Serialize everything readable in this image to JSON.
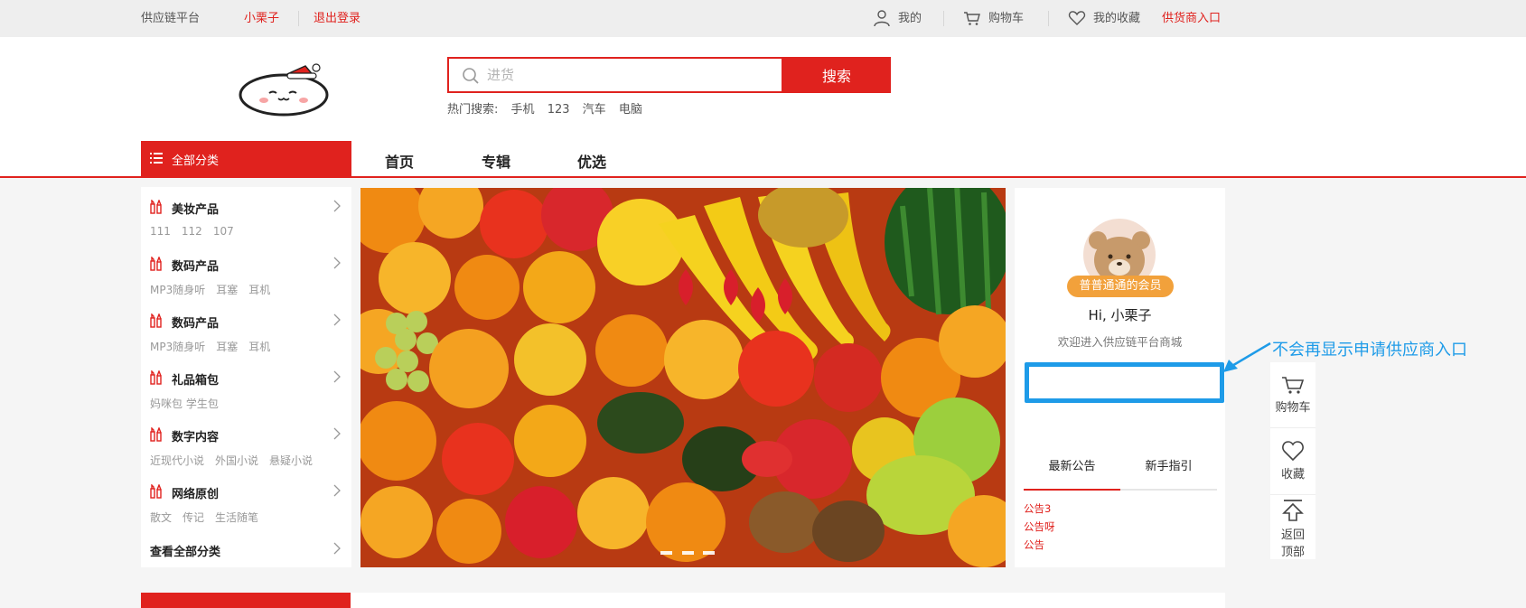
{
  "topbar": {
    "platform": "供应链平台",
    "username": "小栗子",
    "logout": "退出登录",
    "mine": "我的",
    "cart": "购物车",
    "favorites": "我的收藏",
    "supplier_entry": "供货商入口"
  },
  "search": {
    "placeholder": "进货",
    "button": "搜索",
    "hot_label": "热门搜索:",
    "hot_terms": [
      "手机",
      "123",
      "汽车",
      "电脑"
    ]
  },
  "nav": {
    "all_categories": "全部分类",
    "tabs": [
      "首页",
      "专辑",
      "优选"
    ]
  },
  "categories": {
    "items": [
      {
        "name": "美妆产品",
        "subs": [
          "111",
          "112",
          "107"
        ]
      },
      {
        "name": "数码产品",
        "subs": [
          "MP3随身听",
          "耳塞",
          "耳机"
        ]
      },
      {
        "name": "数码产品",
        "subs": [
          "MP3随身听",
          "耳塞",
          "耳机"
        ]
      },
      {
        "name": "礼品箱包",
        "subs": [
          "妈咪包 学生包"
        ]
      },
      {
        "name": "数字内容",
        "subs": [
          "近现代小说",
          "外国小说",
          "悬疑小说"
        ]
      },
      {
        "name": "网络原创",
        "subs": [
          "散文",
          "传记",
          "生活随笔"
        ]
      }
    ],
    "view_all": "查看全部分类"
  },
  "user": {
    "badge": "普普通通的会员",
    "greeting": "Hi, 小栗子",
    "welcome": "欢迎进入供应链平台商城"
  },
  "notice_tabs": [
    "最新公告",
    "新手指引"
  ],
  "notices": [
    "公告3",
    "公告呀",
    "公告"
  ],
  "annotation": "不会再显示申请供应商入口",
  "side_toolbar": {
    "cart": "购物车",
    "favorite": "收藏",
    "back_top_1": "返回",
    "back_top_2": "顶部"
  },
  "colors": {
    "brand_red": "#e0221e",
    "annotation_blue": "#1e9be8",
    "badge_orange": "#f2a13b"
  }
}
